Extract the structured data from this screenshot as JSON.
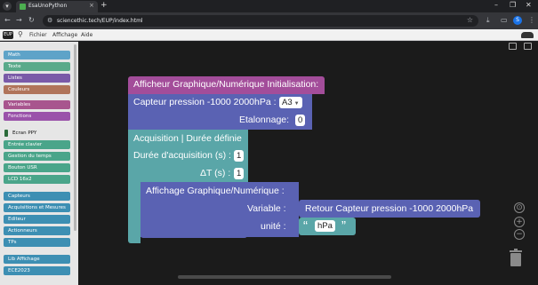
{
  "browser": {
    "tab_title": "EsaUnoPython",
    "url": "sciencethic.tech/EUP/index.html",
    "menu_icon": "chevron-down-icon",
    "new_tab": "+",
    "win_min": "–",
    "win_max": "❐",
    "win_close": "✕",
    "avatar_letter": "S"
  },
  "menubar": {
    "logo": "EUP",
    "items": [
      "Fichier",
      "Affichage",
      "Aide"
    ]
  },
  "toolbox": {
    "categories": [
      {
        "label": "Math",
        "color": "#5ea3c8"
      },
      {
        "label": "Texte",
        "color": "#5aaa8a"
      },
      {
        "label": "Listes",
        "color": "#7a5aa8"
      },
      {
        "label": "Couleurs",
        "color": "#b0745a"
      },
      {
        "label": "Variables",
        "color": "#a8558e"
      },
      {
        "label": "Fonctions",
        "color": "#9a52aa"
      },
      {
        "label": "Ecran PPY",
        "color": "plain"
      },
      {
        "label": "Entrée clavier",
        "color": "#4aa58a"
      },
      {
        "label": "Gestion du temps",
        "color": "#4aa58a"
      },
      {
        "label": "Bouton USR",
        "color": "#4aa58a"
      },
      {
        "label": "LCD 16x2",
        "color": "#4aa58a"
      },
      {
        "label": "Capteurs",
        "color": "#3d8fb3"
      },
      {
        "label": "Acquisitions et Mesures",
        "color": "#3d8fb3"
      },
      {
        "label": "Editeur",
        "color": "#3d8fb3"
      },
      {
        "label": "Actionneurs",
        "color": "#3d8fb3"
      },
      {
        "label": "TPs",
        "color": "#3d8fb3"
      },
      {
        "label": "Lib Affichage",
        "color": "#3d8fb3"
      },
      {
        "label": "ECE2023",
        "color": "#3d8fb3"
      }
    ]
  },
  "blocks": {
    "init_title": "Afficheur Graphique/Numérique Initialisation:",
    "sensor_label": "Capteur pression -1000 2000hPa :",
    "sensor_format": "A3",
    "calibration_label": "Etalonnage:",
    "calibration_value": "0",
    "acq_title": "Acquisition | Durée définie",
    "duration_label": "Durée d'acquisition (s) :",
    "duration_value": "1",
    "dt_label": "ΔT (s) :",
    "dt_value": "1",
    "display_title": "Affichage Graphique/Numérique :",
    "variable_label": "Variable :",
    "return_block": "Retour Capteur pression -1000 2000hPa",
    "unit_label": "unité :",
    "unit_value": "hPa",
    "quote_open": "“",
    "quote_close": "”"
  }
}
